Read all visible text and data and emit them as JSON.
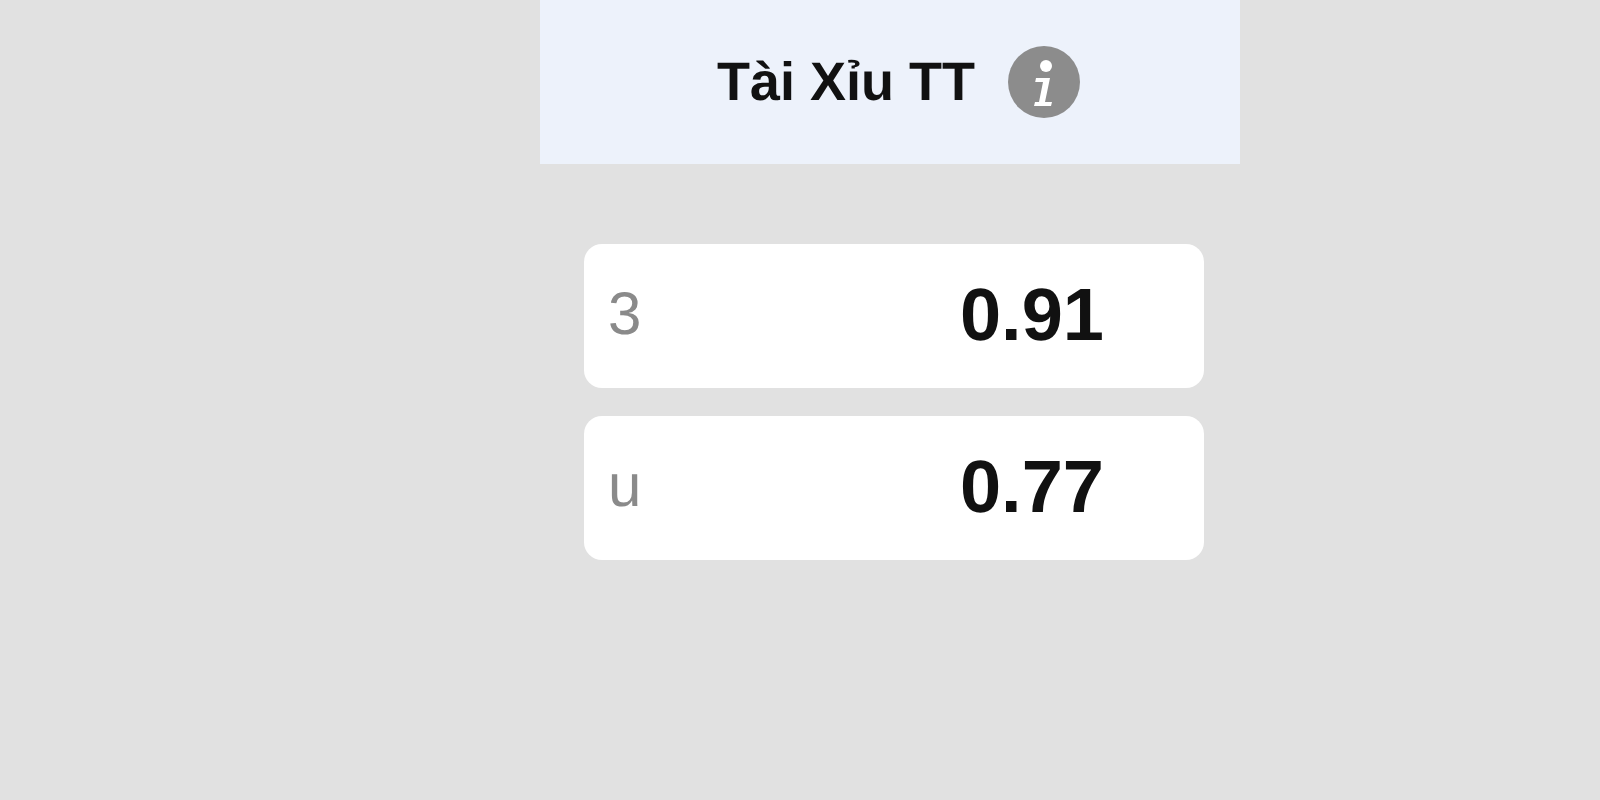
{
  "header": {
    "title": "Tài Xỉu TT"
  },
  "odds": [
    {
      "label": "3",
      "value": "0.91"
    },
    {
      "label": "u",
      "value": "0.77"
    }
  ]
}
